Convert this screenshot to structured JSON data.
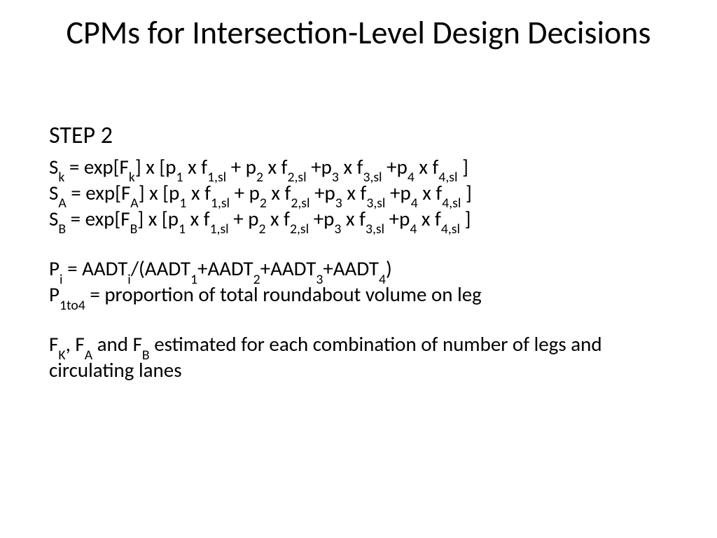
{
  "title": "CPMs for Intersection-Level Design Decisions",
  "step_label": "STEP 2",
  "line_sk": {
    "v": "S",
    "vs": "k",
    "eq": " = exp[F",
    "f1s": "k",
    "mid": "] x [p",
    "p1": "1",
    "xf": " x f",
    "fs1": "1,sl",
    "pl": " + p",
    "p2": "2",
    "fs2": "2,sl",
    "pp": " +p",
    "p3": "3",
    "fs3": "3,sl",
    "p4": "4",
    "fs4": "4,sl",
    "end": " ]"
  },
  "line_sa": {
    "v": "S",
    "vs": "A",
    "eq": " = exp[F",
    "f1s": "A",
    "mid": "] x [p",
    "p1": "1",
    "xf": " x f",
    "fs1": "1,sl",
    "pl": " + p",
    "p2": "2",
    "fs2": "2,sl",
    "pp": " +p",
    "p3": "3",
    "fs3": "3,sl",
    "p4": "4",
    "fs4": "4,sl",
    "end": " ]"
  },
  "line_sb": {
    "v": "S",
    "vs": "B",
    "eq": " = exp[F",
    "f1s": "B",
    "mid": "] x [p",
    "p1": "1",
    "xf": " x f",
    "fs1": "1,sl",
    "pl": " + p",
    "p2": "2",
    "fs2": "2,sl",
    "pp": " +p",
    "p3": "3",
    "fs3": "3,sl",
    "p4": "4",
    "fs4": "4,sl",
    "end": " ]"
  },
  "line_pi": {
    "p": "P",
    "ps": "i",
    "eq": " = AADT",
    "as": "i",
    "div": "/(AADT",
    "a1": "1",
    "pl": "+AADT",
    "a2": "2",
    "a3": "3",
    "a4": "4",
    "end": ")"
  },
  "line_p1to4": {
    "p": "P",
    "ps": "1to4",
    "txt": " = proportion of total roundabout volume on leg"
  },
  "line_f": {
    "f": "F",
    "fk": "K",
    "c1": ", F",
    "fa": "A",
    "c2": " and F",
    "fb": "B",
    "txt": " estimated for each combination of number of legs and circulating lanes"
  }
}
